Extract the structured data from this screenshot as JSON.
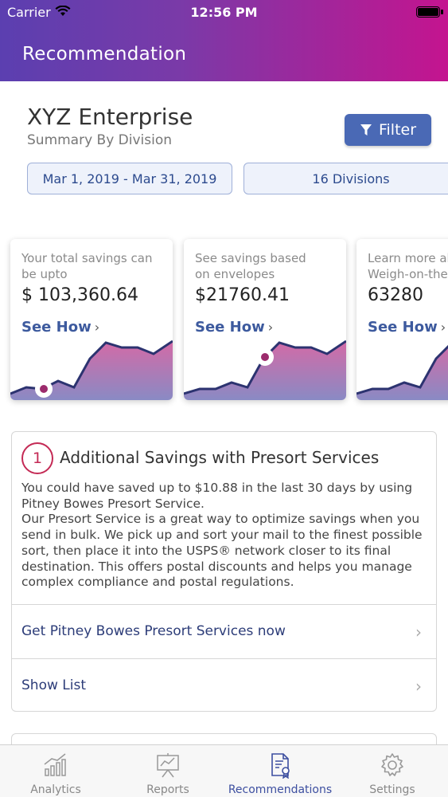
{
  "status_bar": {
    "carrier": "Carrier",
    "time": "12:56 PM"
  },
  "nav": {
    "title": "Recommendation"
  },
  "summary": {
    "company": "XYZ Enterprise",
    "subtitle": "Summary By Division",
    "filter_label": "Filter",
    "date_range": "Mar 1, 2019 - Mar 31, 2019",
    "divisions": "16 Divisions"
  },
  "cards": [
    {
      "text": "Your total savings can\nbe upto",
      "value": "$ 103,360.64",
      "link": "See How"
    },
    {
      "text": "See savings based\non envelopes",
      "value": "$21760.41",
      "link": "See How"
    },
    {
      "text": "Learn more about\nWeigh-on-the-go",
      "value": "63280",
      "link": "See How"
    }
  ],
  "recommendation": {
    "number": "1",
    "title": "Additional Savings with Presort Services",
    "body": "You could have saved up to $10.88 in the last 30 days by using Pitney Bowes Presort Service.\n Our Presort Service is a great way to optimize savings when you send in bulk. We pick up and sort your mail to the finest possible sort, then place it into the USPS® network closer to its final destination. This offers postal discounts and helps you manage complex compliance and postal regulations.",
    "action_label": "Get Pitney Bowes Presort Services now",
    "list_label": "Show List"
  },
  "tabs": [
    {
      "label": "Analytics",
      "icon": "analytics-icon",
      "active": false
    },
    {
      "label": "Reports",
      "icon": "reports-icon",
      "active": false
    },
    {
      "label": "Recommendations",
      "icon": "recommendations-icon",
      "active": true
    },
    {
      "label": "Settings",
      "icon": "gear-icon",
      "active": false
    }
  ],
  "colors": {
    "header_start": "#5b3fb0",
    "header_end": "#c4148f",
    "accent": "#4a69b5",
    "badge": "#c42a55"
  }
}
